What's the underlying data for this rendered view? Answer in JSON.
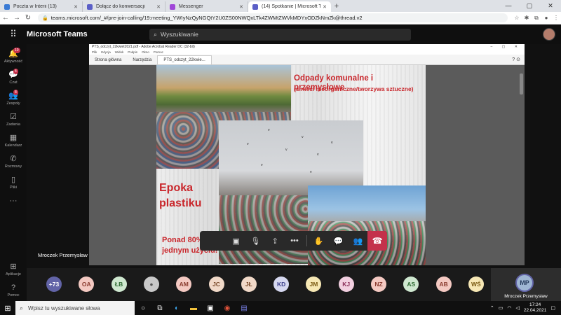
{
  "browser": {
    "tabs": [
      {
        "label": "Poczta w Interii (13)",
        "icon": "mail-icon",
        "color": "#3a7bd5"
      },
      {
        "label": "Dołącz do konwersacji",
        "icon": "teams-icon",
        "color": "#5b5fc7"
      },
      {
        "label": "Messenger",
        "icon": "messenger-icon",
        "color": "#a046d8"
      },
      {
        "label": "(14) Spotkanie | Microsoft Te",
        "icon": "teams-icon",
        "color": "#5b5fc7"
      }
    ],
    "address": "teams.microsoft.com/_#/pre-join-calling/19:meeting_YWIyNzQyNGQtY2U0ZS00NWQxLTk4ZWMtZWVkMDYxODZkNmZk@thread.v2"
  },
  "teams": {
    "app_name": "Microsoft Teams",
    "search_placeholder": "Wyszukiwanie",
    "rail": [
      {
        "label": "Aktywność",
        "icon": "bell-icon",
        "badge": "10"
      },
      {
        "label": "Czat",
        "icon": "chat-icon",
        "badge": "4"
      },
      {
        "label": "Zespoły",
        "icon": "teams-people-icon",
        "badge": "8"
      },
      {
        "label": "Zadania",
        "icon": "tasks-icon",
        "badge": ""
      },
      {
        "label": "Kalendarz",
        "icon": "calendar-icon",
        "badge": ""
      },
      {
        "label": "Rozmowy",
        "icon": "phone-icon",
        "badge": ""
      },
      {
        "label": "Pliki",
        "icon": "file-icon",
        "badge": ""
      },
      {
        "label": "",
        "icon": "more-icon",
        "badge": ""
      }
    ],
    "rail_bottom": [
      {
        "label": "Aplikacje",
        "icon": "apps-icon"
      },
      {
        "label": "Pomoc",
        "icon": "help-icon"
      }
    ]
  },
  "acrobat": {
    "title": "PTS_odczyt_22kwiet2021.pdf - Adobe Acrobat Reader DC (32-bit)",
    "menu": [
      "Plik",
      "Edycja",
      "Widok",
      "Podpis",
      "Okno",
      "Pomoc"
    ],
    "tabs": [
      "Strona główna",
      "Narzędzia",
      "PTS_odczyt_22kwie..."
    ]
  },
  "slide": {
    "heading": "Odpady komunalne i przemysłowe",
    "subheading": "(śmieci nieorganiczne/tworzywa sztuczne)",
    "epoka": "Epoka plastiku",
    "ponad": "Ponad 80% ... wysypiska śmieci po jednym użyciu!",
    "accent": "#c9272c"
  },
  "speaker_name": "Mroczek Przemysław",
  "call_controls": {
    "timer": "",
    "buttons": [
      {
        "name": "camera-off-button",
        "icon": "camera-off-icon",
        "glyph": "▣"
      },
      {
        "name": "mic-off-button",
        "icon": "mic-off-icon",
        "glyph": "🎙"
      },
      {
        "name": "share-button",
        "icon": "share-icon",
        "glyph": "⇪"
      },
      {
        "name": "more-actions-button",
        "icon": "more-icon",
        "glyph": "•••"
      },
      {
        "name": "raise-hand-button",
        "icon": "hand-icon",
        "glyph": "✋"
      },
      {
        "name": "chat-button",
        "icon": "chat-icon",
        "glyph": "💬"
      },
      {
        "name": "participants-button",
        "icon": "people-icon",
        "glyph": "👥"
      }
    ],
    "hangup_icon": "hangup-icon"
  },
  "participants": [
    {
      "initials": "+73",
      "bg": "#6264a7",
      "fg": "#ffffff"
    },
    {
      "initials": "OA",
      "bg": "#f4c9c2",
      "fg": "#8a3b2f"
    },
    {
      "initials": "ŁB",
      "bg": "#cfe8d0",
      "fg": "#2e6b32"
    },
    {
      "initials": "",
      "bg": "#c8c8c8",
      "fg": "#555555",
      "icon": "person-icon"
    },
    {
      "initials": "AM",
      "bg": "#f4c9c2",
      "fg": "#8a3b2f"
    },
    {
      "initials": "JC",
      "bg": "#f1d9c8",
      "fg": "#7a4a2a"
    },
    {
      "initials": "JŁ",
      "bg": "#f1d9c8",
      "fg": "#7a4a2a"
    },
    {
      "initials": "KD",
      "bg": "#d6d8f0",
      "fg": "#3a3e8a"
    },
    {
      "initials": "JM",
      "bg": "#f6e7b4",
      "fg": "#7a5a12"
    },
    {
      "initials": "KJ",
      "bg": "#f2cfe0",
      "fg": "#8a2f5a"
    },
    {
      "initials": "NZ",
      "bg": "#f4c9c2",
      "fg": "#8a3b2f"
    },
    {
      "initials": "AS",
      "bg": "#cfe8d0",
      "fg": "#2e6b32"
    },
    {
      "initials": "AB",
      "bg": "#f4c9c2",
      "fg": "#8a3b2f"
    },
    {
      "initials": "WŚ",
      "bg": "#f6e7b4",
      "fg": "#7a5a12"
    }
  ],
  "me": {
    "initials": "MP",
    "name": "Mroczek Przemysław"
  },
  "taskbar": {
    "search_placeholder": "Wpisz tu wyszukiwane słowa",
    "time": "17:24",
    "date": "22.04.2021"
  }
}
